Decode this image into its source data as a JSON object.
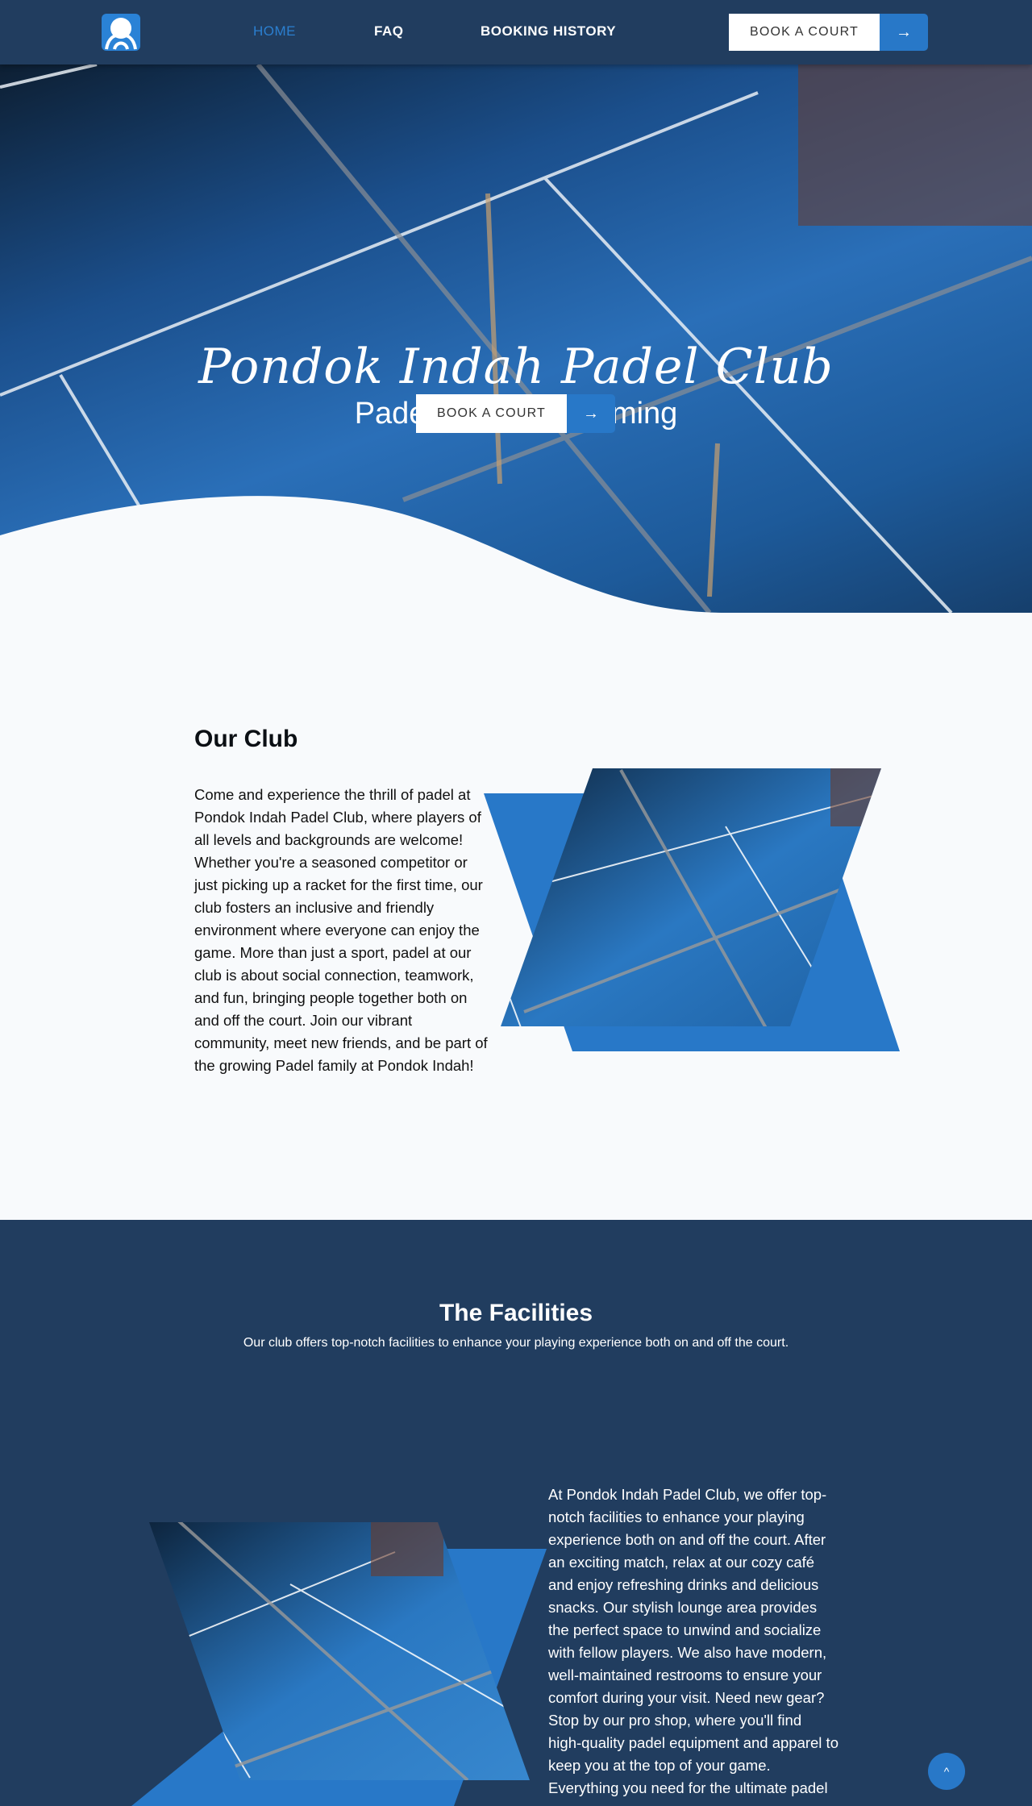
{
  "nav": {
    "items": [
      {
        "label": "HOME",
        "active": true
      },
      {
        "label": "FAQ",
        "active": false
      },
      {
        "label": "BOOKING HISTORY",
        "active": false
      }
    ],
    "book_label": "BOOK A COURT",
    "book_icon": "arrow-right-icon"
  },
  "hero": {
    "title": "Pondok Indah Padel Club",
    "subtitle": "Padel Made Welcoming",
    "book_label": "BOOK A COURT",
    "book_arrow": "→"
  },
  "club": {
    "title": "Our Club",
    "text": "Come and experience the thrill of padel at Pondok Indah Padel Club, where players of all levels and backgrounds are welcome! Whether you're a seasoned competitor or just picking up a racket for the first time, our club fosters an inclusive and friendly environment where everyone can enjoy the game. More than just a sport, padel at our club is about social connection, teamwork, and fun, bringing people together both on and off the court. Join our vibrant community, meet new friends, and be part of the growing Padel family at Pondok Indah!"
  },
  "facilities": {
    "title": "The Facilities",
    "subtitle": "Our club offers top-notch facilities to enhance your playing experience both on and off the court.",
    "text": "At Pondok Indah Padel Club, we offer top-notch facilities to enhance your playing experience both on and off the court. After an exciting match, relax at our cozy café and enjoy refreshing drinks and delicious snacks. Our stylish lounge area provides the perfect space to unwind and socialize with fellow players. We also have modern, well-maintained restrooms to ensure your comfort during your visit. Need new gear? Stop by our pro shop, where you'll find high-quality padel equipment and apparel to keep you at the top of your game. Everything you need for the ultimate padel"
  },
  "scroll_top": {
    "label": "^"
  },
  "colors": {
    "nav": "#213d5f",
    "accent": "#2878c8",
    "light_bg": "#f8fafc"
  }
}
